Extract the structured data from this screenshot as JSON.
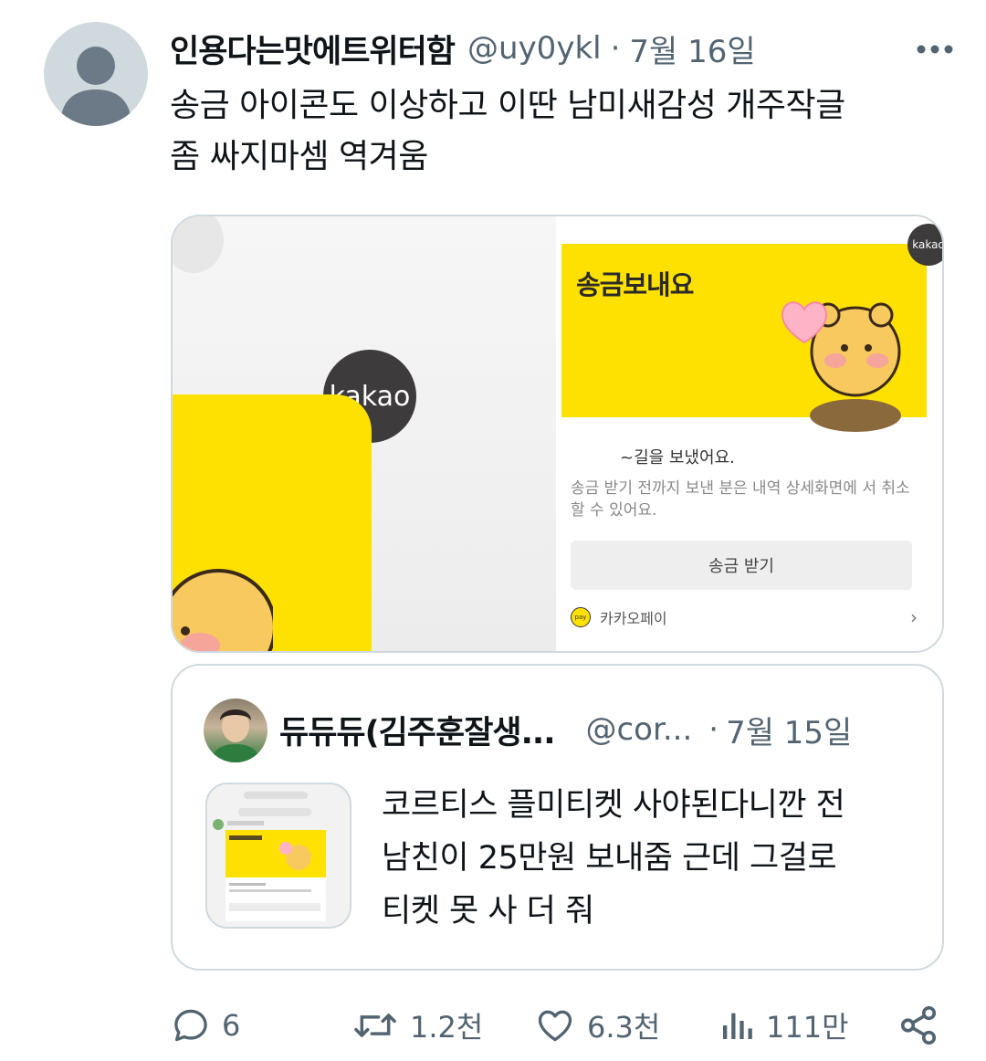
{
  "tweet": {
    "display_name": "인용다는맛에트위터함",
    "handle": "@uy0ykl",
    "separator": "·",
    "date": "7월 16일",
    "text_line1": "송금 아이콘도 이상하고 이딴 남미새감성 개주작글",
    "text_line2": "좀 싸지마셈 역겨움"
  },
  "media": {
    "left_logo_text": "kakao",
    "right_logo_text": "kakao",
    "card_title": "송금보내요",
    "sent_line": "~길을 보냈어요.",
    "description": "송금 받기 전까지 보낸 분은 내역 상세화면에 서 취소할 수 있어요.",
    "receive_button": "송금 받기",
    "pay_label": "카카오페이",
    "pay_icon_text": "pay",
    "chevron": "›"
  },
  "quote": {
    "display_name": "듀듀듀(김주훈잘생...",
    "handle": "@cor...",
    "separator": "·",
    "date": "7월 15일",
    "text_line1": "코르티스 플미티켓 사야된다니깐 전",
    "text_line2": "남친이 25만원 보내줌 근데 그걸로",
    "text_line3": "티켓 못 사 더 줘"
  },
  "actions": {
    "reply_count": "6",
    "retweet_count": "1.2천",
    "like_count": "6.3천",
    "view_count": "111만"
  },
  "icons": [
    "more-icon",
    "reply-icon",
    "retweet-icon",
    "like-icon",
    "views-icon",
    "share-icon"
  ],
  "colors": {
    "text": "#0f1419",
    "secondary": "#536471",
    "border": "#cfd9de",
    "kakao_yellow": "#ffe100"
  }
}
